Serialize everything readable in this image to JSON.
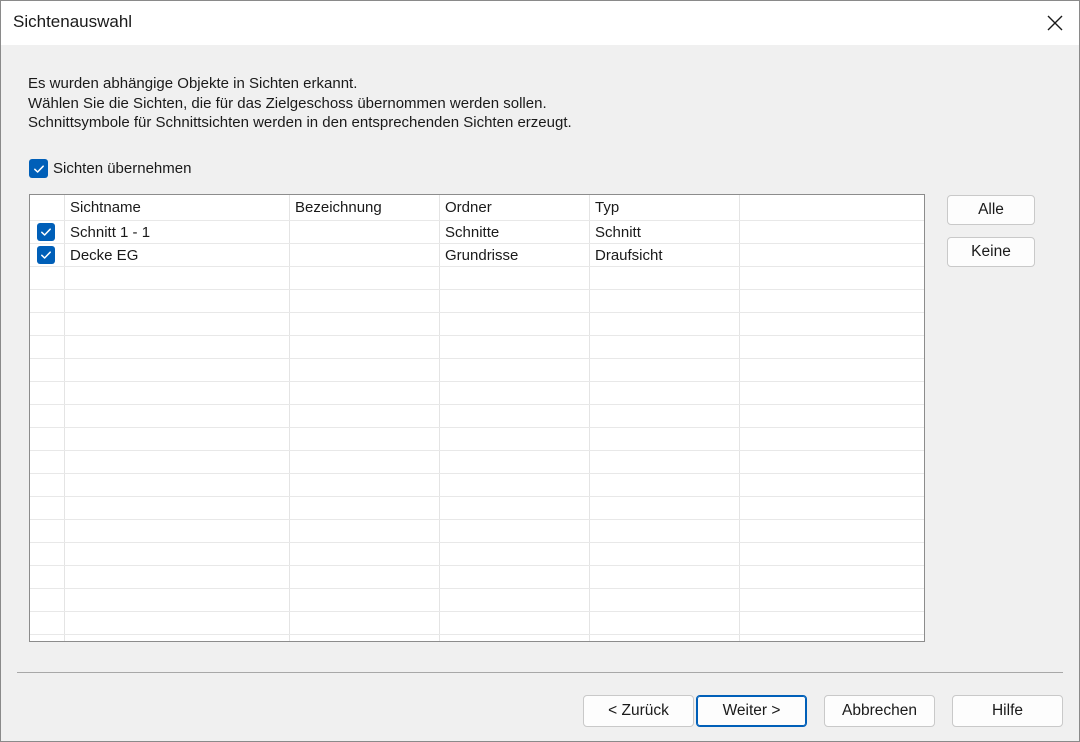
{
  "window": {
    "title": "Sichtenauswahl"
  },
  "message": [
    "Es wurden abhängige Objekte in Sichten erkannt.",
    "Wählen Sie die Sichten, die für das Zielgeschoss übernommen werden sollen.",
    "Schnittsymbole für Schnittsichten werden in den entsprechenden Sichten erzeugt."
  ],
  "take_over": {
    "label": "Sichten übernehmen",
    "checked": true
  },
  "table": {
    "columns": [
      "Sichtname",
      "Bezeichnung",
      "Ordner",
      "Typ"
    ],
    "rows": [
      {
        "checked": true,
        "sichtname": "Schnitt 1 - 1",
        "bezeichnung": "",
        "ordner": "Schnitte",
        "typ": "Schnitt"
      },
      {
        "checked": true,
        "sichtname": "Decke EG",
        "bezeichnung": "",
        "ordner": "Grundrisse",
        "typ": "Draufsicht"
      }
    ]
  },
  "side_buttons": {
    "all": "Alle",
    "none": "Keine"
  },
  "footer": {
    "back": "< Zurück",
    "next": "Weiter >",
    "cancel": "Abbrechen",
    "help": "Hilfe"
  },
  "colors": {
    "accent": "#005fb8",
    "background": "#f0f0f0",
    "title_bar": "#ffffff"
  }
}
